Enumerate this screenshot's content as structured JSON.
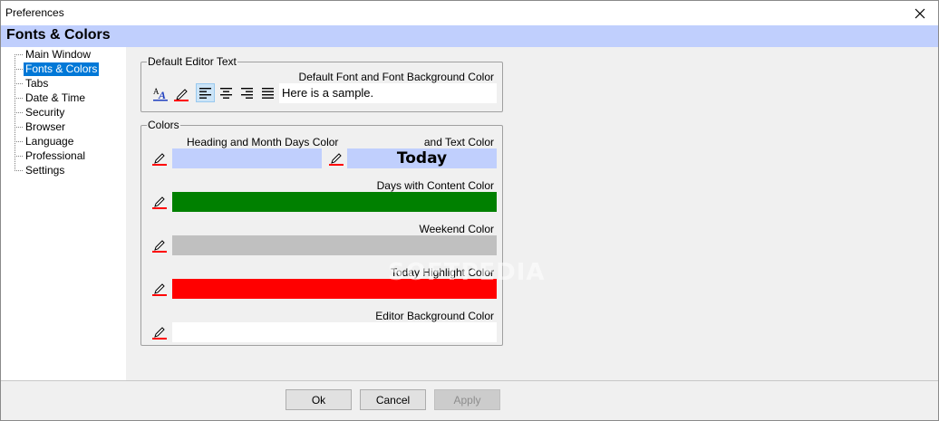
{
  "window": {
    "title": "Preferences"
  },
  "page": {
    "title": "Fonts & Colors"
  },
  "sidebar": {
    "items": [
      {
        "label": "Main Window",
        "selected": false
      },
      {
        "label": "Fonts & Colors",
        "selected": true
      },
      {
        "label": "Tabs",
        "selected": false
      },
      {
        "label": "Date & Time",
        "selected": false
      },
      {
        "label": "Security",
        "selected": false
      },
      {
        "label": "Browser",
        "selected": false
      },
      {
        "label": "Language",
        "selected": false
      },
      {
        "label": "Professional",
        "selected": false
      },
      {
        "label": "Settings",
        "selected": false
      }
    ]
  },
  "editor_text": {
    "group_label": "Default Editor Text",
    "font_label": "Default Font and Font Background Color",
    "sample_text": "Here is a sample.",
    "toolbar_icons": [
      "font-icon",
      "pencil-icon",
      "align-left-icon",
      "align-center-icon",
      "align-right-icon",
      "align-justify-icon"
    ]
  },
  "colors": {
    "group_label": "Colors",
    "heading_label": "Heading and Month Days Color",
    "text_color_label": "and Text Color",
    "today_text": "Today",
    "content_label": "Days with Content Color",
    "weekend_label": "Weekend Color",
    "highlight_label": "Today Highlight Color",
    "background_label": "Editor Background Color",
    "swatches": {
      "heading": "#c0cffd",
      "content": "#008000",
      "weekend": "#c0c0c0",
      "highlight": "#ff0000",
      "background": "#ffffff"
    }
  },
  "buttons": {
    "ok": "Ok",
    "cancel": "Cancel",
    "apply": "Apply"
  },
  "watermark": "SOFTPEDIA"
}
